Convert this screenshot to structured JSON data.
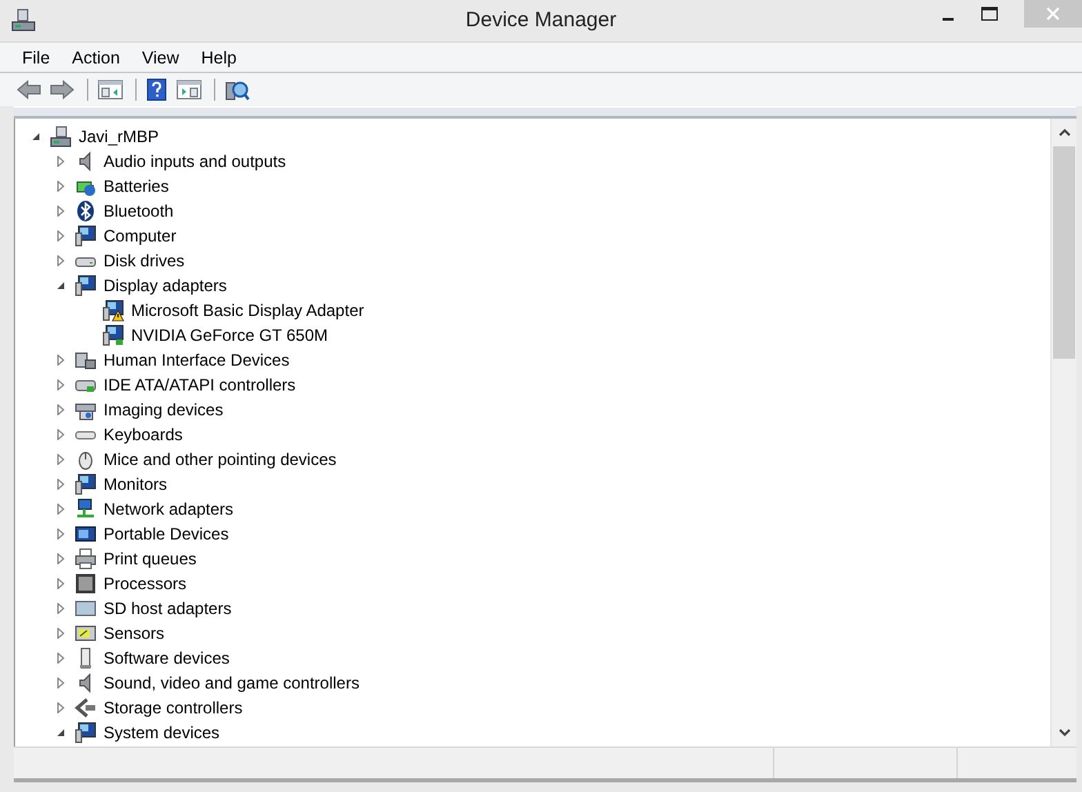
{
  "window": {
    "title": "Device Manager"
  },
  "menu": [
    "File",
    "Action",
    "View",
    "Help"
  ],
  "tree": {
    "label": "Javi_rMBP",
    "expanded": true,
    "children": [
      {
        "label": "Audio inputs and outputs",
        "expanded": false
      },
      {
        "label": "Batteries",
        "expanded": false
      },
      {
        "label": "Bluetooth",
        "expanded": false
      },
      {
        "label": "Computer",
        "expanded": false
      },
      {
        "label": "Disk drives",
        "expanded": false
      },
      {
        "label": "Display adapters",
        "expanded": true,
        "children": [
          {
            "label": "Microsoft Basic Display Adapter",
            "warning": true
          },
          {
            "label": "NVIDIA GeForce GT 650M",
            "warning": false
          }
        ]
      },
      {
        "label": "Human Interface Devices",
        "expanded": false
      },
      {
        "label": "IDE ATA/ATAPI controllers",
        "expanded": false
      },
      {
        "label": "Imaging devices",
        "expanded": false
      },
      {
        "label": "Keyboards",
        "expanded": false
      },
      {
        "label": "Mice and other pointing devices",
        "expanded": false
      },
      {
        "label": "Monitors",
        "expanded": false
      },
      {
        "label": "Network adapters",
        "expanded": false
      },
      {
        "label": "Portable Devices",
        "expanded": false
      },
      {
        "label": "Print queues",
        "expanded": false
      },
      {
        "label": "Processors",
        "expanded": false
      },
      {
        "label": "SD host adapters",
        "expanded": false
      },
      {
        "label": "Sensors",
        "expanded": false
      },
      {
        "label": "Software devices",
        "expanded": false
      },
      {
        "label": "Sound, video and game controllers",
        "expanded": false
      },
      {
        "label": "Storage controllers",
        "expanded": false
      },
      {
        "label": "System devices",
        "expanded": true
      }
    ]
  }
}
